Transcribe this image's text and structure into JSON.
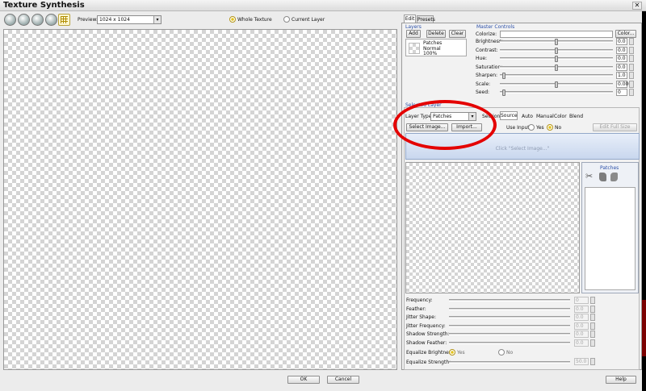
{
  "window": {
    "title": "Texture Synthesis",
    "close_glyph": "✕"
  },
  "toolbar": {
    "preview_label": "Preview:",
    "preview_value": "1024 x 1024",
    "whole_texture_label": "Whole Texture",
    "current_layer_label": "Current Layer",
    "icons": [
      "zoom-in-icon",
      "zoom-out-icon",
      "zoom-fit-icon",
      "zoom-actual-icon",
      "tile-grid-icon"
    ]
  },
  "right_tabs": [
    "Edit",
    "Presets"
  ],
  "layers": {
    "title": "Layers",
    "add": "Add",
    "delete": "Delete",
    "clear": "Clear",
    "item": {
      "name": "Patches",
      "mode": "Normal",
      "opacity": "100%"
    }
  },
  "master_controls": {
    "title": "Master Controls",
    "colorize_label": "Colorize:",
    "color_button": "Color...",
    "sliders": [
      {
        "label": "Brightness:",
        "value": "0.0",
        "pos": 0.5
      },
      {
        "label": "Contrast:",
        "value": "0.0",
        "pos": 0.5
      },
      {
        "label": "Hue:",
        "value": "0.0",
        "pos": 0.5
      },
      {
        "label": "Saturation:",
        "value": "0.0",
        "pos": 0.5
      },
      {
        "label": "Sharpen:",
        "value": "1.0",
        "pos": 0.02
      },
      {
        "label": "Scale:",
        "value": "0.000",
        "pos": 0.5
      },
      {
        "label": "Seed:",
        "value": "0",
        "pos": 0.02
      }
    ]
  },
  "selected_layer": {
    "title": "Selected Layer",
    "layer_type_label": "Layer Type:",
    "layer_type_value": "Patches",
    "section_label": "Section:",
    "tabs": [
      "Source",
      "Auto",
      "Manual",
      "Color",
      "Blend"
    ],
    "select_image_button": "Select Image...",
    "import_button": "Import...",
    "use_input_label": "Use Input:",
    "yes_label": "Yes",
    "no_label": "No",
    "edit_full_size_button": "Edit Full Size",
    "drop_hint": "Click \"Select Image...\"",
    "patches_title": "Patches"
  },
  "params": [
    {
      "label": "Frequency:",
      "value": "0"
    },
    {
      "label": "Feather:",
      "value": "0.0"
    },
    {
      "label": "Jitter Shape:",
      "value": "0.0"
    },
    {
      "label": "Jitter Frequency:",
      "value": "0.0"
    },
    {
      "label": "Shadow Strength:",
      "value": "0.0"
    },
    {
      "label": "Shadow Feather:",
      "value": "0.0"
    }
  ],
  "equalize": {
    "brightness_label": "Equalize Brightness:",
    "yes_label": "Yes",
    "no_label": "No",
    "strength_label": "Equalize Strength:",
    "strength_value": "50.0"
  },
  "footer": {
    "ok": "OK",
    "cancel": "Cancel",
    "help": "Help"
  },
  "annotation": {
    "color": "#e40000"
  }
}
